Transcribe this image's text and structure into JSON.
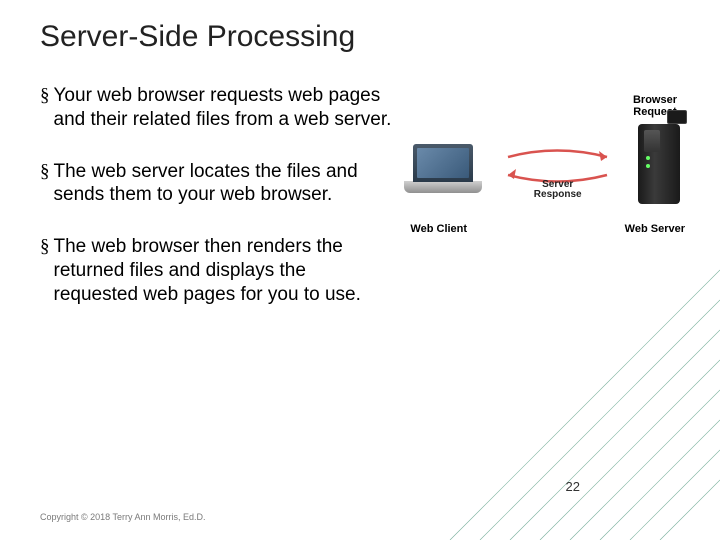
{
  "title": "Server-Side Processing",
  "bullets": [
    "Your web browser requests web pages and their related files from a web server.",
    "The web server locates the files and sends them to your web browser.",
    "The web browser then renders the returned files and displays the requested web pages for you to use."
  ],
  "bullet_marker": "§",
  "diagram": {
    "browser_request": "Browser\nRequest",
    "server_response": "Server\nResponse",
    "web_client": "Web Client",
    "web_server": "Web Server"
  },
  "page_number": "22",
  "copyright": "Copyright © 2018 Terry Ann Morris, Ed.D.",
  "colors": {
    "accent": "#1e7b5a"
  }
}
